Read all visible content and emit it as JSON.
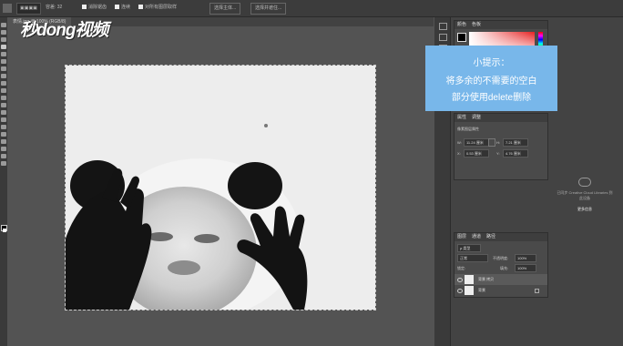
{
  "watermark": "秒dong视频",
  "options": {
    "feather_label": "羽化:",
    "feather_value": "0",
    "antialias": "消除锯齿",
    "style_label": "样式:",
    "style_value": "正常",
    "mode_value": "选择并遮住...",
    "scale_label": "缩放:",
    "scale_value": "100%",
    "tolerance": "容差: 32",
    "contiguous": "连续",
    "sample_all": "对所有图层取样",
    "select_subject": "选择主体..."
  },
  "document_tab": "表情.jpg @ 100% (RGB/8)",
  "hint": {
    "title": "小提示：",
    "line1": "将多余的不需要的空白",
    "line2": "部分使用delete删除"
  },
  "color_panel": {
    "tab1": "颜色",
    "tab2": "色板"
  },
  "properties_panel": {
    "tab1": "属性",
    "tab2": "调整",
    "subtitle": "像素图层属性",
    "w_label": "W:",
    "w_value": "11.24 厘米",
    "h_label": "H:",
    "h_value": "7.21 厘米",
    "x_label": "X:",
    "x_value": "0.53 厘米",
    "y_label": "Y:",
    "y_value": "4.76 厘米"
  },
  "layers_panel": {
    "tab1": "图层",
    "tab2": "通道",
    "tab3": "路径",
    "kind_value": "ρ 类型",
    "blend_value": "正常",
    "opacity_label": "不透明度:",
    "opacity_value": "100%",
    "lock_label": "锁定:",
    "fill_label": "填充:",
    "fill_value": "100%",
    "layers": [
      {
        "name": "背景 拷贝"
      },
      {
        "name": "背景"
      }
    ]
  },
  "cloud_info": {
    "line1": "已同步 Creative Cloud Libraries 到",
    "line2": "此设备",
    "link": "更多信息"
  },
  "colors": {
    "hint_bg": "#78b7ea",
    "workspace": "#535353"
  }
}
